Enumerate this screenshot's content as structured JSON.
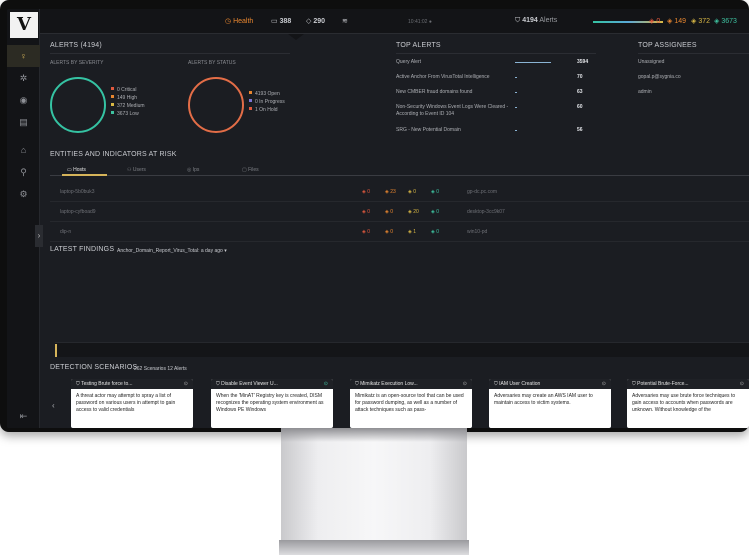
{
  "topbar": {
    "health_label": "Health",
    "hosts_count": "388",
    "indicators_count": "290",
    "center_text": "10:41:02 ●",
    "alerts_count": "4194",
    "alerts_label": "Alerts",
    "sev_critical": "0",
    "sev_high": "149",
    "sev_medium": "372",
    "sev_low": "3673"
  },
  "alerts": {
    "title": "ALERTS (4194)",
    "by_severity_title": "ALERTS BY SEVERITY",
    "by_status_title": "ALERTS BY STATUS",
    "severity_legend": [
      "0 Critical",
      "149 High",
      "372 Medium",
      "3673 Low"
    ],
    "status_legend": [
      "4193 Open",
      "0 In Progress",
      "1 On Hold"
    ]
  },
  "top_alerts": {
    "title": "TOP ALERTS",
    "rows": [
      {
        "name": "Query Alert",
        "count": "3594",
        "fill": 1.0
      },
      {
        "name": "Active Anchor From VirusTotal Intelligence",
        "count": "70",
        "fill": 0.02
      },
      {
        "name": "New CMBER fraud domains found",
        "count": "63",
        "fill": 0.02
      },
      {
        "name": "Non-Security Windows Event Logs Were Cleared - According to Event ID 104",
        "count": "60",
        "fill": 0.02
      },
      {
        "name": "SRG - New Potential Domain",
        "count": "56",
        "fill": 0.02
      }
    ]
  },
  "top_assignees": {
    "title": "TOP ASSIGNEES",
    "rows": [
      "Unassigned",
      "gopal.p@sygnia.co",
      "admin"
    ]
  },
  "entities": {
    "title": "ENTITIES AND INDICATORS AT RISK",
    "tabs": [
      "Hosts",
      "Users",
      "Ips",
      "Files"
    ],
    "rows": [
      {
        "left": "laptop-5b0buk3",
        "c1": "0",
        "c2": "23",
        "c3": "0",
        "c4": "0",
        "right": "gp-dc.pc.com"
      },
      {
        "left": "laptop-cyfboad9",
        "c1": "0",
        "c2": "0",
        "c3": "20",
        "c4": "0",
        "right": "desktop-3cc9k07"
      },
      {
        "left": "dip-n",
        "c1": "0",
        "c2": "0",
        "c3": "1",
        "c4": "0",
        "right": "win10-pd"
      }
    ]
  },
  "findings": {
    "title": "LATEST FINDINGS",
    "selector": "Anchor_Domain_Report_Virus_Total: a day ago"
  },
  "detection": {
    "title": "DETECTION SCENARIOS",
    "summary": "262 Scenarios 12 Alerts",
    "cards": [
      {
        "title": "Testing Brute force to...",
        "body": "A threat actor may attempt to spray a list of password on various users in attempt to gain access to valid credentials"
      },
      {
        "title": "Disable Event Viewer U...",
        "body": "When the 'MinAT' Registry key is created, DISM recognizes the operating system environment as Windows PE Windows"
      },
      {
        "title": "Mimikatz Execution Low...",
        "body": "Mimikatz is an open-source tool that can be used for password dumping, as well as a number of attack techniques such as pass-"
      },
      {
        "title": "IAM User Creation",
        "body": "Adversaries may create an AWS IAM user to maintain access to victim systems."
      },
      {
        "title": "Potential Brute-Force...",
        "body": "Adversaries may use brute force techniques to gain access to accounts when passwords are unknown. Without knowledge of the"
      }
    ]
  },
  "colors": {
    "critical": "#e2593e",
    "high": "#e8862f",
    "medium": "#d9b845",
    "low": "#3ec2a0",
    "accent": "#d6b45a"
  }
}
